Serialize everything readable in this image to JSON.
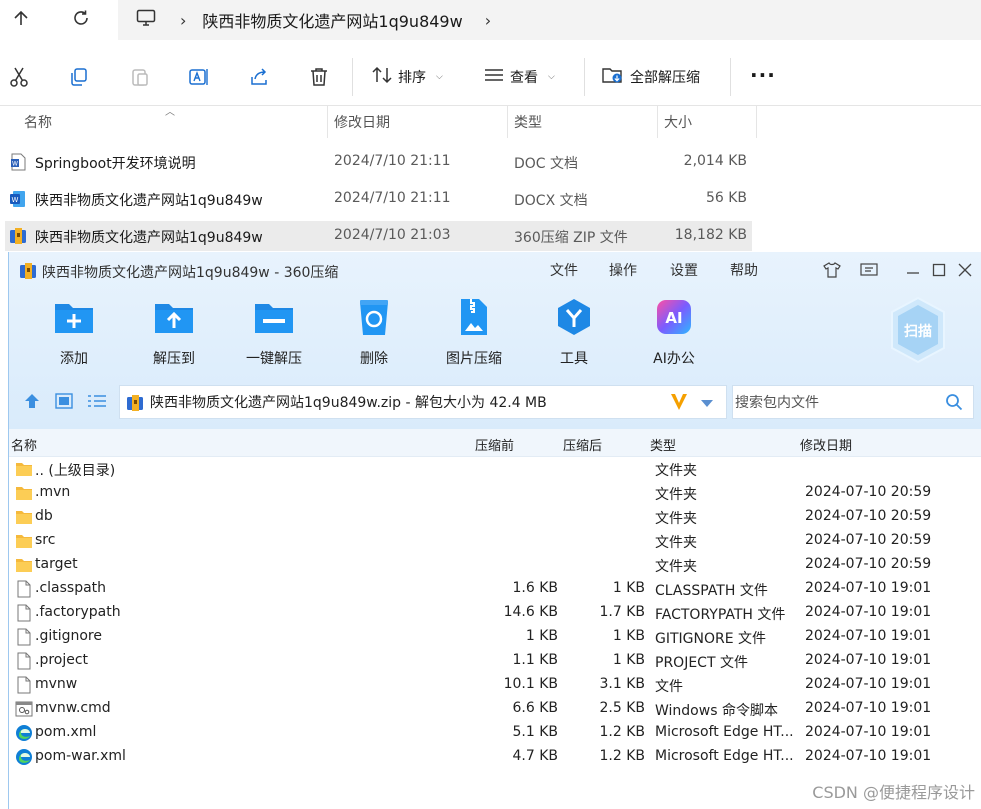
{
  "explorer": {
    "breadcrumb": "陕西非物质文化遗产网站1q9u849w",
    "toolbar": {
      "sort_label": "排序",
      "view_label": "查看",
      "extract_all_label": "全部解压缩"
    },
    "columns": {
      "name": "名称",
      "date": "修改日期",
      "type": "类型",
      "size": "大小"
    },
    "files": [
      {
        "name": "Springboot开发环境说明",
        "date": "2024/7/10 21:11",
        "type": "DOC 文档",
        "size": "2,014 KB",
        "icon": "word-doc-icon"
      },
      {
        "name": "陕西非物质文化遗产网站1q9u849w",
        "date": "2024/7/10 21:11",
        "type": "DOCX 文档",
        "size": "56 KB",
        "icon": "word-docx-icon"
      },
      {
        "name": "陕西非物质文化遗产网站1q9u849w",
        "date": "2024/7/10 21:03",
        "type": "360压缩 ZIP 文件",
        "size": "18,182 KB",
        "icon": "zip-archive-icon"
      }
    ]
  },
  "zip": {
    "title": "陕西非物质文化遗产网站1q9u849w - 360压缩",
    "menu": [
      "文件",
      "操作",
      "设置",
      "帮助"
    ],
    "tools": [
      "添加",
      "解压到",
      "一键解压",
      "删除",
      "图片压缩",
      "工具",
      "AI办公"
    ],
    "ai_badge": "AI",
    "scan_label": "扫描",
    "path_text": "陕西非物质文化遗产网站1q9u849w.zip - 解包大小为 42.4 MB",
    "search_placeholder": "搜索包内文件",
    "columns": {
      "name": "名称",
      "before": "压缩前",
      "after": "压缩后",
      "type": "类型",
      "date": "修改日期"
    },
    "rows": [
      {
        "name": ".. (上级目录)",
        "before": "",
        "after": "",
        "type": "文件夹",
        "date": "",
        "kind": "folder"
      },
      {
        "name": ".mvn",
        "before": "",
        "after": "",
        "type": "文件夹",
        "date": "2024-07-10 20:59",
        "kind": "folder"
      },
      {
        "name": "db",
        "before": "",
        "after": "",
        "type": "文件夹",
        "date": "2024-07-10 20:59",
        "kind": "folder"
      },
      {
        "name": "src",
        "before": "",
        "after": "",
        "type": "文件夹",
        "date": "2024-07-10 20:59",
        "kind": "folder"
      },
      {
        "name": "target",
        "before": "",
        "after": "",
        "type": "文件夹",
        "date": "2024-07-10 20:59",
        "kind": "folder"
      },
      {
        "name": ".classpath",
        "before": "1.6 KB",
        "after": "1 KB",
        "type": "CLASSPATH 文件",
        "date": "2024-07-10 19:01",
        "kind": "file"
      },
      {
        "name": ".factorypath",
        "before": "14.6 KB",
        "after": "1.7 KB",
        "type": "FACTORYPATH 文件",
        "date": "2024-07-10 19:01",
        "kind": "file"
      },
      {
        "name": ".gitignore",
        "before": "1 KB",
        "after": "1 KB",
        "type": "GITIGNORE 文件",
        "date": "2024-07-10 19:01",
        "kind": "file"
      },
      {
        "name": ".project",
        "before": "1.1 KB",
        "after": "1 KB",
        "type": "PROJECT 文件",
        "date": "2024-07-10 19:01",
        "kind": "file"
      },
      {
        "name": "mvnw",
        "before": "10.1 KB",
        "after": "3.1 KB",
        "type": "文件",
        "date": "2024-07-10 19:01",
        "kind": "file"
      },
      {
        "name": "mvnw.cmd",
        "before": "6.6 KB",
        "after": "2.5 KB",
        "type": "Windows 命令脚本",
        "date": "2024-07-10 19:01",
        "kind": "cmd"
      },
      {
        "name": "pom.xml",
        "before": "5.1 KB",
        "after": "1.2 KB",
        "type": "Microsoft Edge HT...",
        "date": "2024-07-10 19:01",
        "kind": "edge"
      },
      {
        "name": "pom-war.xml",
        "before": "4.7 KB",
        "after": "1.2 KB",
        "type": "Microsoft Edge HT...",
        "date": "2024-07-10 19:01",
        "kind": "edge"
      }
    ]
  },
  "watermark": "CSDN @便捷程序设计"
}
